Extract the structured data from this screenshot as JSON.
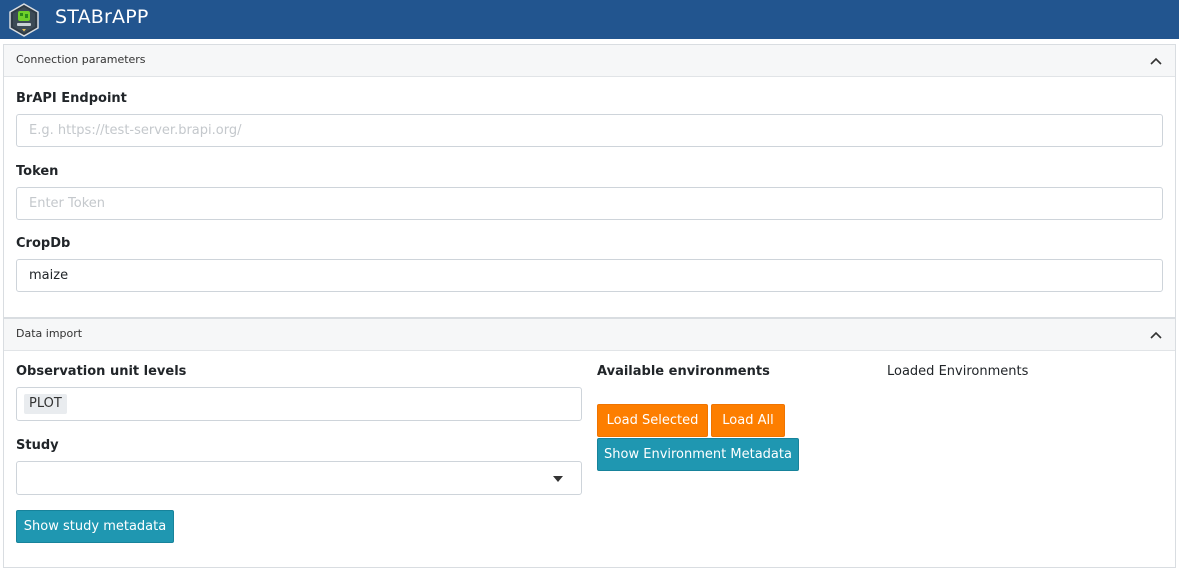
{
  "app": {
    "title": "STABrAPP"
  },
  "connection": {
    "header": "Connection parameters",
    "endpoint_label": "BrAPI Endpoint",
    "endpoint_placeholder": "E.g. https://test-server.brapi.org/",
    "endpoint_value": "",
    "token_label": "Token",
    "token_placeholder": "Enter Token",
    "token_value": "",
    "cropdb_label": "CropDb",
    "cropdb_value": "maize"
  },
  "data_import": {
    "header": "Data import",
    "obs_unit_label": "Observation unit levels",
    "obs_unit_selected": "PLOT",
    "study_label": "Study",
    "study_selected": "",
    "show_study_metadata": "Show study metadata",
    "available_env_label": "Available environments",
    "load_selected": "Load Selected",
    "load_all": "Load All",
    "show_env_metadata": "Show Environment Metadata",
    "loaded_env_label": "Loaded Environments"
  },
  "colors": {
    "navbar": "#22558f",
    "orange_button": "#fd7e00",
    "teal_button": "#1f97b1"
  },
  "icons": [
    "app-logo-icon",
    "chevron-up-icon",
    "caret-down-icon"
  ]
}
